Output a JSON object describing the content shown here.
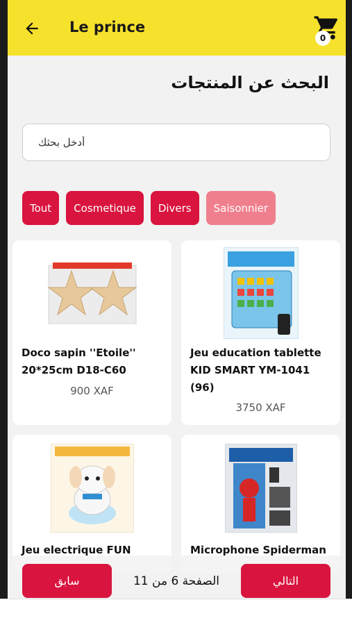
{
  "header": {
    "title": "Le prince",
    "cart_count": "0"
  },
  "page_heading": "البحث عن المنتجات",
  "search": {
    "placeholder": "أدخل بحثك",
    "value": ""
  },
  "filters": [
    {
      "label": "Tout",
      "active": true
    },
    {
      "label": "Cosmetique",
      "active": true
    },
    {
      "label": "Divers",
      "active": true
    },
    {
      "label": "Saisonnier",
      "active": false
    }
  ],
  "products": [
    {
      "name": "Doco sapin ''Etoile'' 20*25cm D18-C60",
      "price": "900 XAF",
      "image_icon": "star-decoration-image"
    },
    {
      "name": "Jeu education tablette KID SMART YM-1041 (96)",
      "price": "3750 XAF",
      "image_icon": "kids-tablet-image"
    },
    {
      "name": "Jeu electrique FUN",
      "price": "",
      "image_icon": "robot-dog-toy-image"
    },
    {
      "name": "Microphone Spiderman",
      "price": "",
      "image_icon": "spiderman-microphone-image"
    }
  ],
  "pagination": {
    "prev_label": "سابق",
    "next_label": "التالي",
    "status": "الصفحة 6 من 11"
  },
  "colors": {
    "app_bar": "#f6e12c",
    "accent": "#d9143e",
    "chip_inactive": "#f07f8d"
  }
}
